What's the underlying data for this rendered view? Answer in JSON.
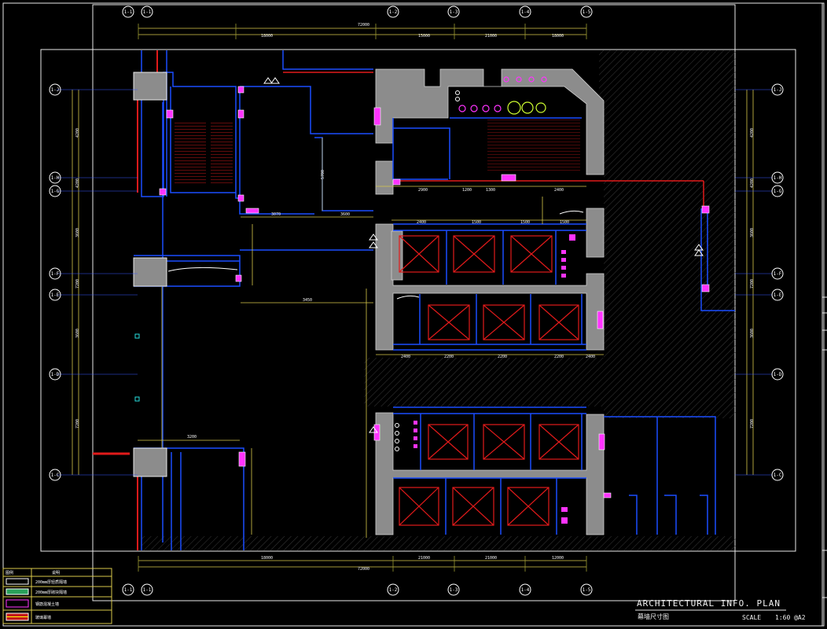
{
  "title_block": {
    "drawing_title": "ARCHITECTURAL INFO. PLAN",
    "subtitle": "幕墙尺寸图",
    "scale_label": "SCALE",
    "scale_value": "1:60 @A2"
  },
  "grid_bubbles": {
    "top": [
      "1-1",
      "1-1",
      "1-2",
      "1-3",
      "1-4",
      "1-5"
    ],
    "bottom": [
      "1-1",
      "1-1",
      "1-2",
      "1-3",
      "1-4",
      "1-5"
    ],
    "left": [
      "1-J",
      "1-H",
      "1-G",
      "1-F",
      "1-E",
      "1-D",
      "1-C"
    ],
    "right": [
      "1-J",
      "1-H",
      "1-G",
      "1-F",
      "1-E",
      "1-D",
      "1-C"
    ]
  },
  "legend": {
    "header": [
      "图例",
      "说明"
    ],
    "rows": [
      "200mm厚轻质隔墙",
      "200mm厚砌块隔墙",
      "钢筋混凝土墙",
      "玻璃幕墙"
    ]
  },
  "dimensions": {
    "top_total": "72000",
    "top_segments": [
      "18000",
      "15000",
      "21000",
      "18000"
    ],
    "bottom_total": "72000",
    "bottom_segments": [
      "18000",
      "21000",
      "21000",
      "12000"
    ],
    "shaft_top": [
      "2900",
      "1200",
      "1300",
      "2400"
    ],
    "elev_row1": [
      "2400",
      "1500",
      "1500",
      "1500"
    ],
    "elev_row2": [
      "2400",
      "2200",
      "2200",
      "2200",
      "2400"
    ],
    "lobby": [
      "3070",
      "3600",
      "3450",
      "3200",
      "5700"
    ],
    "left_side": [
      "4200",
      "4200",
      "3600",
      "7200",
      "3600",
      "7200"
    ],
    "right_side": [
      "4200",
      "4200",
      "3600",
      "7200",
      "3600",
      "7200"
    ]
  },
  "colors": {
    "background": "#000000",
    "wall_fill": "#8c8c8c",
    "blue_line": "#1a4dff",
    "dim_line": "#d8c84a",
    "red_line": "#e11a1a",
    "magenta": "#ff33ff",
    "hatch": "#444444"
  }
}
